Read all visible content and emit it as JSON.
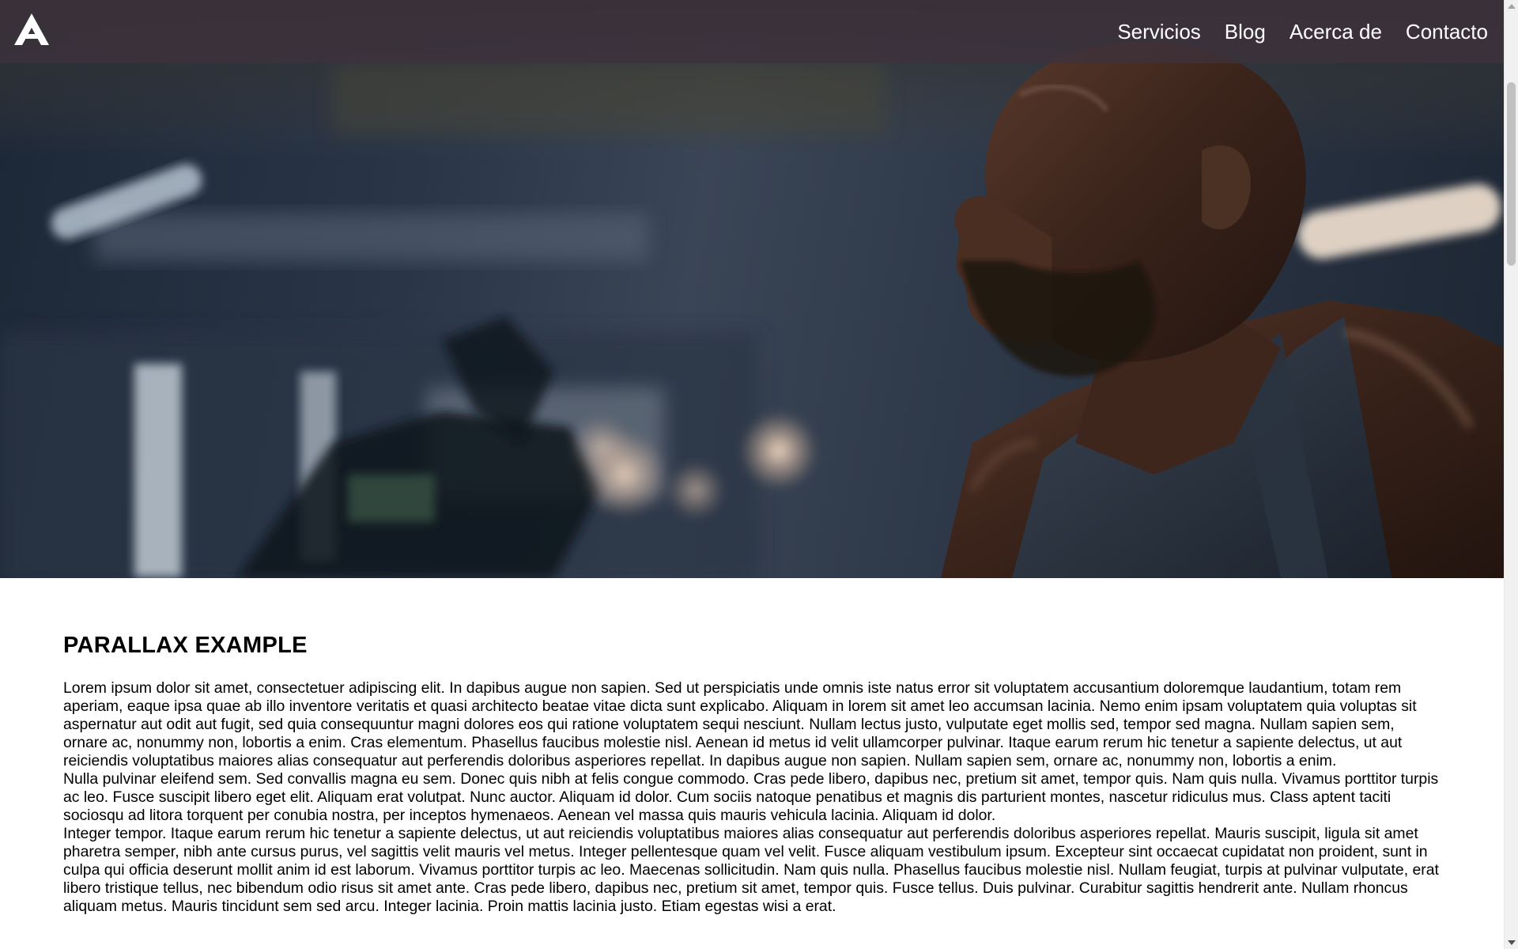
{
  "navbar": {
    "logo_icon": "triangle-a-logo-icon",
    "links": [
      {
        "label": "Servicios"
      },
      {
        "label": "Blog"
      },
      {
        "label": "Acerca de"
      },
      {
        "label": "Contacto"
      }
    ]
  },
  "hero": {
    "image": "gym-athlete-photo"
  },
  "content": {
    "title": "PARALLAX EXAMPLE",
    "paragraphs": [
      "Lorem ipsum dolor sit amet, consectetuer adipiscing elit. In dapibus augue non sapien. Sed ut perspiciatis unde omnis iste natus error sit voluptatem accusantium doloremque laudantium, totam rem aperiam, eaque ipsa quae ab illo inventore veritatis et quasi architecto beatae vitae dicta sunt explicabo. Aliquam in lorem sit amet leo accumsan lacinia. Nemo enim ipsam voluptatem quia voluptas sit aspernatur aut odit aut fugit, sed quia consequuntur magni dolores eos qui ratione voluptatem sequi nesciunt. Nullam lectus justo, vulputate eget mollis sed, tempor sed magna. Nullam sapien sem, ornare ac, nonummy non, lobortis a enim. Cras elementum. Phasellus faucibus molestie nisl. Aenean id metus id velit ullamcorper pulvinar. Itaque earum rerum hic tenetur a sapiente delectus, ut aut reiciendis voluptatibus maiores alias consequatur aut perferendis doloribus asperiores repellat. In dapibus augue non sapien. Nullam sapien sem, ornare ac, nonummy non, lobortis a enim.",
      "Nulla pulvinar eleifend sem. Sed convallis magna eu sem. Donec quis nibh at felis congue commodo. Cras pede libero, dapibus nec, pretium sit amet, tempor quis. Nam quis nulla. Vivamus porttitor turpis ac leo. Fusce suscipit libero eget elit. Aliquam erat volutpat. Nunc auctor. Aliquam id dolor. Cum sociis natoque penatibus et magnis dis parturient montes, nascetur ridiculus mus. Class aptent taciti sociosqu ad litora torquent per conubia nostra, per inceptos hymenaeos. Aenean vel massa quis mauris vehicula lacinia. Aliquam id dolor.",
      "Integer tempor. Itaque earum rerum hic tenetur a sapiente delectus, ut aut reiciendis voluptatibus maiores alias consequatur aut perferendis doloribus asperiores repellat. Mauris suscipit, ligula sit amet pharetra semper, nibh ante cursus purus, vel sagittis velit mauris vel metus. Integer pellentesque quam vel velit. Fusce aliquam vestibulum ipsum. Excepteur sint occaecat cupidatat non proident, sunt in culpa qui officia deserunt mollit anim id est laborum. Vivamus porttitor turpis ac leo. Maecenas sollicitudin. Nam quis nulla. Phasellus faucibus molestie nisl. Nullam feugiat, turpis at pulvinar vulputate, erat libero tristique tellus, nec bibendum odio risus sit amet ante. Cras pede libero, dapibus nec, pretium sit amet, tempor quis. Fusce tellus. Duis pulvinar. Curabitur sagittis hendrerit ante. Nullam rhoncus aliquam metus. Mauris tincidunt sem sed arcu. Integer lacinia. Proin mattis lacinia justo. Etiam egestas wisi a erat."
    ]
  },
  "colors": {
    "navbar_bg": "#3e323c",
    "text": "#000000",
    "nav_text": "#ffffff"
  }
}
